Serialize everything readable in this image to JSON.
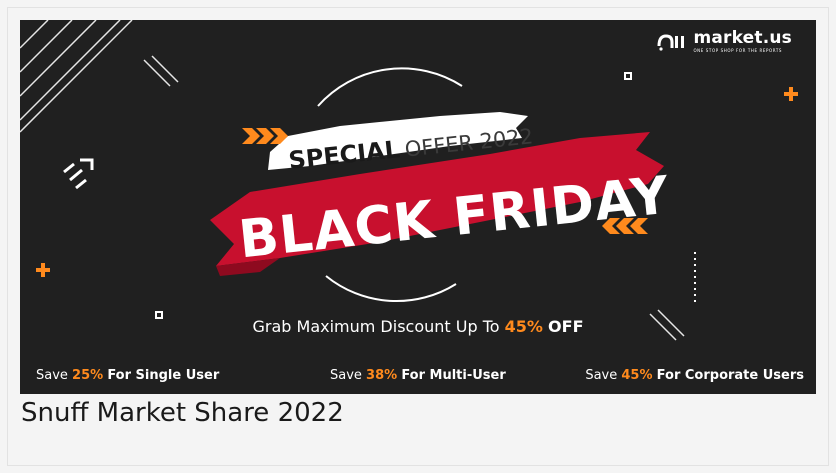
{
  "logo": {
    "name": "market.us",
    "tagline": "ONE STOP SHOP FOR THE REPORTS"
  },
  "headline": {
    "special": "SPECIAL",
    "offer": "OFFER 2022",
    "main": "BLACK FRIDAY"
  },
  "promo": {
    "prefix": "Grab Maximum Discount Up To ",
    "percent": "45%",
    "suffix": "OFF"
  },
  "offers": [
    {
      "save": "Save ",
      "percent": "25%",
      "label": "For Single User"
    },
    {
      "save": "Save ",
      "percent": "38%",
      "label": "For Multi-User"
    },
    {
      "save": "Save ",
      "percent": "45%",
      "label": "For Corporate Users"
    }
  ],
  "caption": "Snuff Market Share 2022",
  "colors": {
    "accent": "#ff8a1d",
    "brush_red": "#c8102e",
    "background": "#202020"
  }
}
